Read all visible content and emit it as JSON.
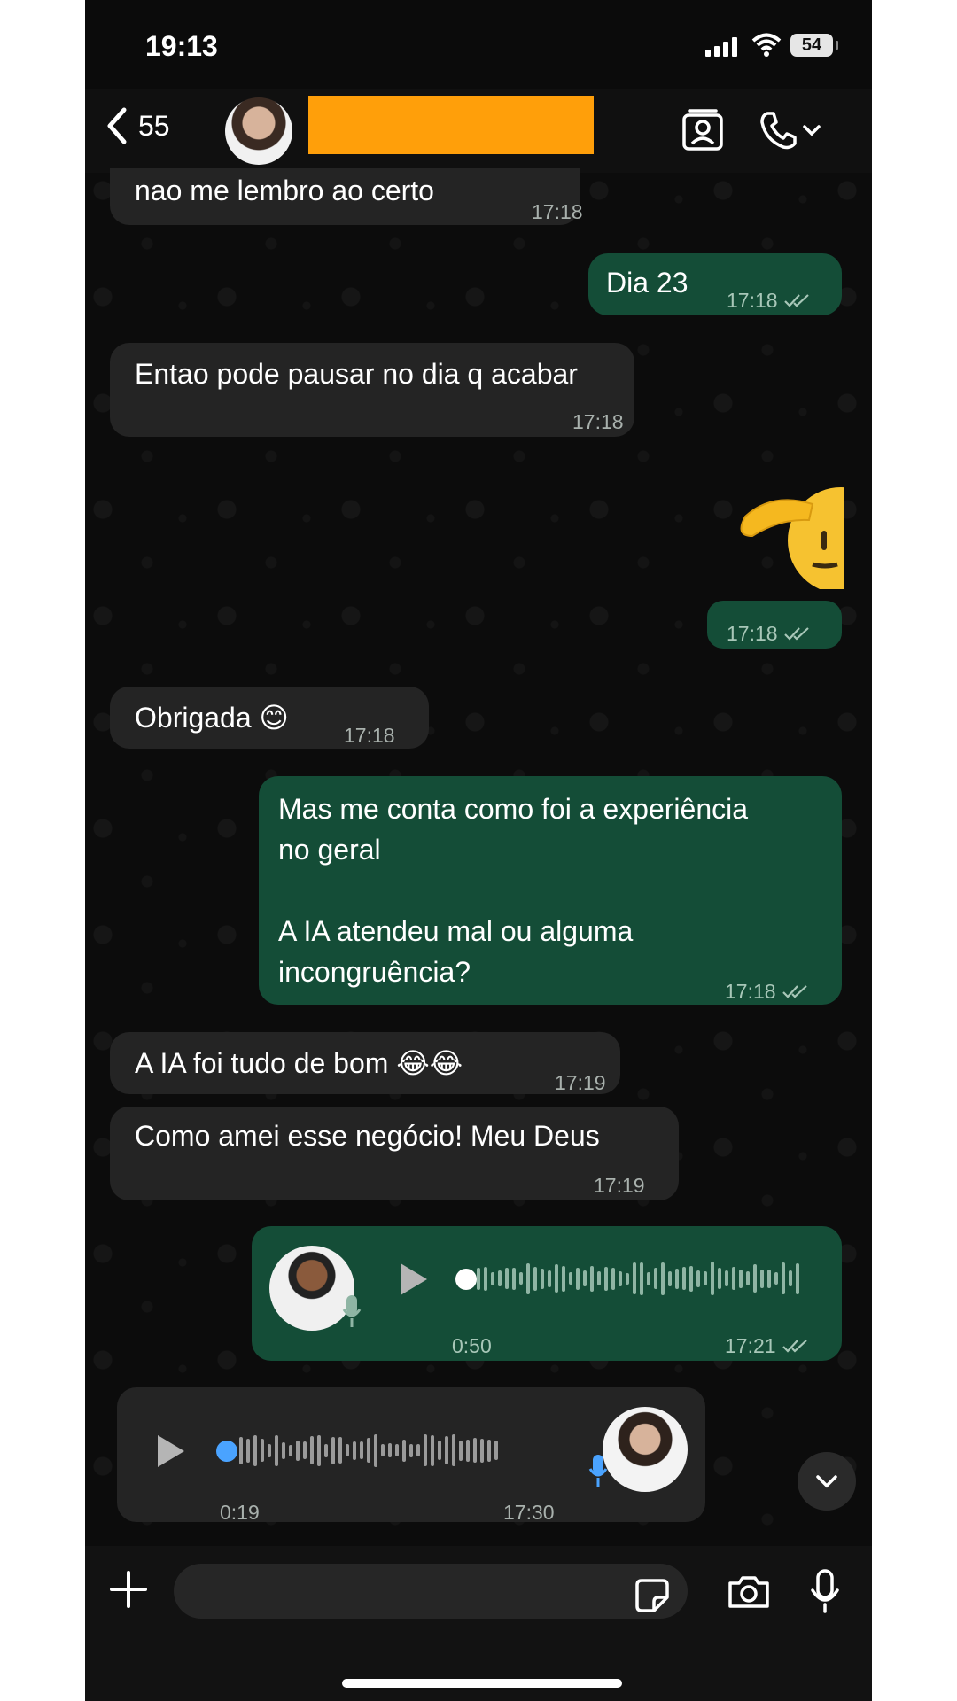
{
  "status_bar": {
    "time": "19:13",
    "battery": "54"
  },
  "header": {
    "back_count": "55"
  },
  "messages": [
    {
      "dir": "in",
      "text": "nao me lembro ao certo",
      "time": "17:18"
    },
    {
      "dir": "out",
      "text": "Dia 23",
      "time": "17:18"
    },
    {
      "dir": "in",
      "text": "Entao pode pausar no dia q acabar",
      "time": "17:18"
    },
    {
      "dir": "out",
      "type": "sticker",
      "sticker": "saluting-face-emoji",
      "time": "17:18"
    },
    {
      "dir": "in",
      "text": "Obrigada 😊",
      "time": "17:18"
    },
    {
      "dir": "out",
      "text": "Mas me conta como foi a experiência\nno geral\n\nA IA atendeu mal ou alguma\nincongruência?",
      "time": "17:18"
    },
    {
      "dir": "in",
      "text": "A IA foi tudo de bom  😂😂",
      "time": "17:19"
    },
    {
      "dir": "in",
      "text": "Como amei esse negócio! Meu Deus",
      "time": "17:19"
    },
    {
      "dir": "out",
      "type": "voice",
      "duration": "0:50",
      "time": "17:21"
    },
    {
      "dir": "in",
      "type": "voice",
      "duration": "0:19",
      "time": "17:30"
    }
  ],
  "colors": {
    "incoming_bubble": "#242424",
    "outgoing_bubble": "#144d37",
    "voice_dot_out": "#ffffff",
    "voice_dot_in": "#4aa3ff",
    "redaction": "#ff9f0a"
  }
}
